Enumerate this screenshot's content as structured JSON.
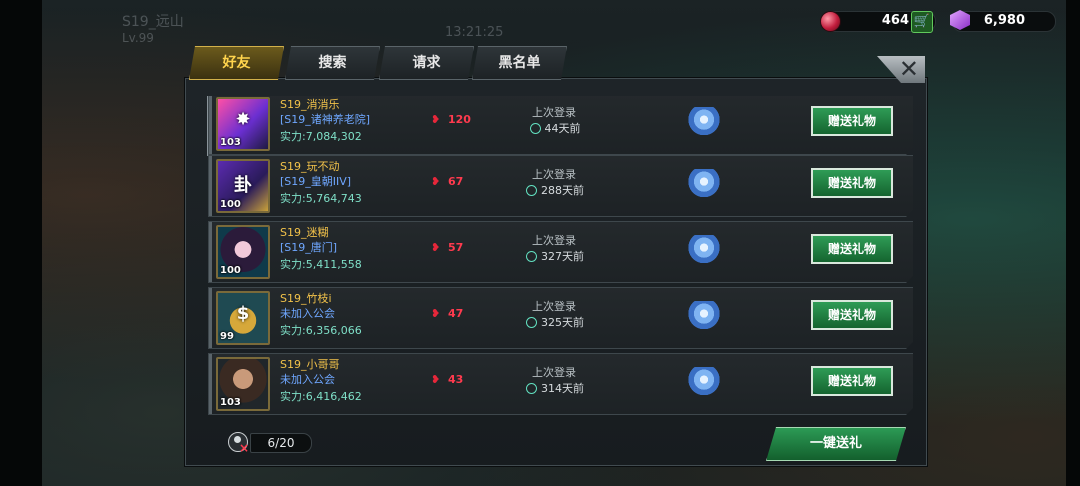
{
  "hud": {
    "player_name": "S19_远山",
    "player_level": "Lv.99",
    "clock": "13:21:25",
    "gems": "464",
    "crystals": "6,980"
  },
  "tabs": [
    {
      "label": "好友",
      "active": true
    },
    {
      "label": "搜索",
      "active": false
    },
    {
      "label": "请求",
      "active": false
    },
    {
      "label": "黑名单",
      "active": false
    }
  ],
  "close_label": "✕",
  "friends": [
    {
      "name": "S19_消消乐",
      "guild": "[S19_诸神养老院]",
      "power": "实力:7,084,302",
      "level": "103",
      "hearts": "120",
      "login_label": "上次登录",
      "login_ago": "44天前",
      "gift_label": "赠送礼物"
    },
    {
      "name": "S19_玩不动",
      "guild": "[S19_皇朝IIV]",
      "power": "实力:5,764,743",
      "level": "100",
      "hearts": "67",
      "login_label": "上次登录",
      "login_ago": "288天前",
      "gift_label": "赠送礼物"
    },
    {
      "name": "S19_迷糊",
      "guild": "[S19_唐门]",
      "power": "实力:5,411,558",
      "level": "100",
      "hearts": "57",
      "login_label": "上次登录",
      "login_ago": "327天前",
      "gift_label": "赠送礼物"
    },
    {
      "name": "S19_竹枝i",
      "guild": "未加入公会",
      "power": "实力:6,356,066",
      "level": "99",
      "hearts": "47",
      "login_label": "上次登录",
      "login_ago": "325天前",
      "gift_label": "赠送礼物"
    },
    {
      "name": "S19_小哥哥",
      "guild": "未加入公会",
      "power": "实力:6,416,462",
      "level": "103",
      "hearts": "43",
      "login_label": "上次登录",
      "login_ago": "314天前",
      "gift_label": "赠送礼物"
    }
  ],
  "footer": {
    "friend_count": "6/20",
    "send_all_label": "一键送礼"
  },
  "colors": {
    "name_gold": "#f2c24a",
    "guild_blue": "#6fa7ff",
    "power_teal": "#7fe0c8",
    "heart_red": "#ff3a4e",
    "button_green": "#2f9c56"
  }
}
